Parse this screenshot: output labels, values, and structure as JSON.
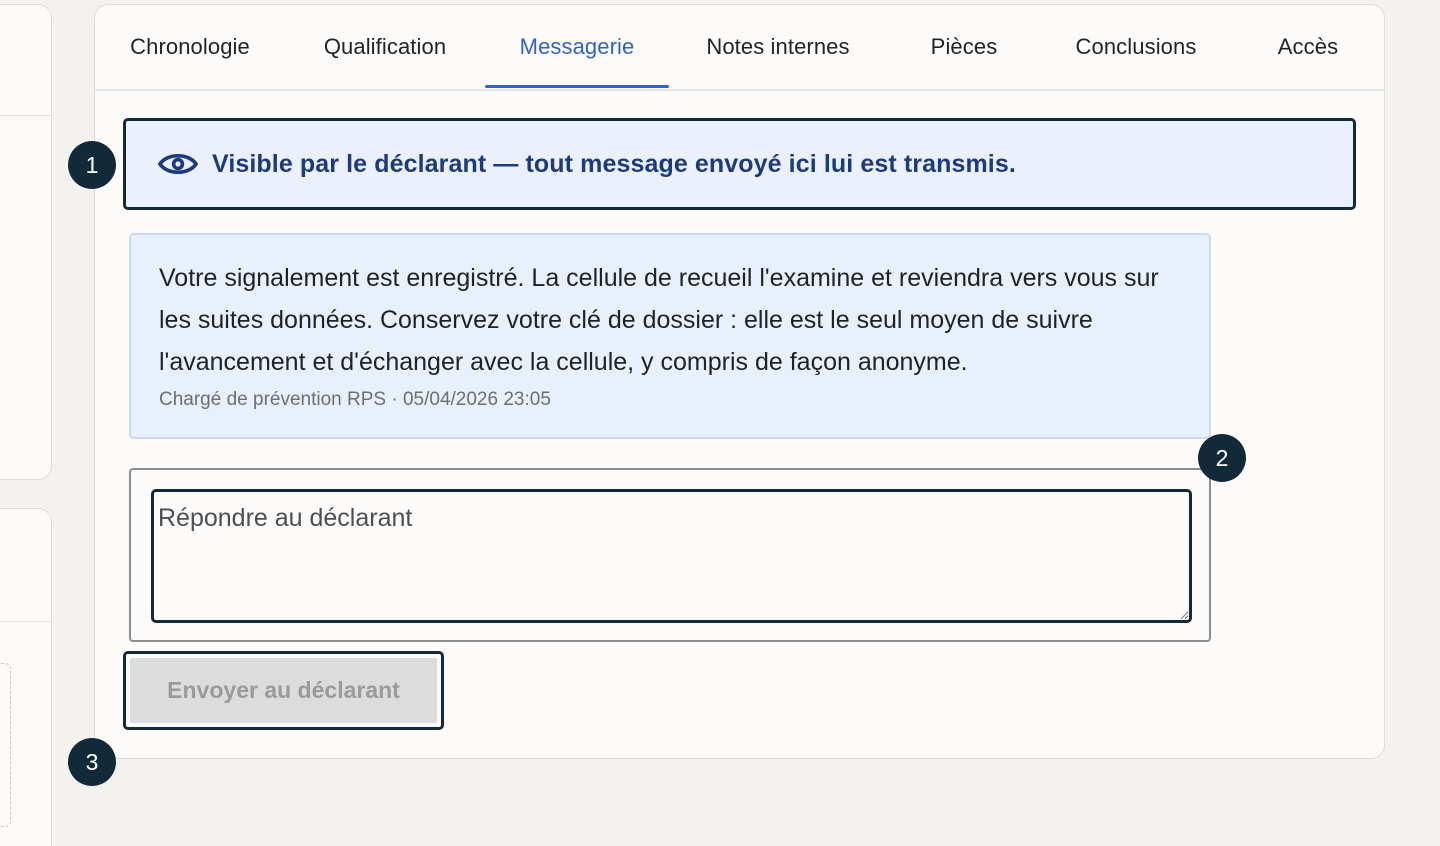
{
  "tabs": [
    {
      "label": "Chronologie"
    },
    {
      "label": "Qualification"
    },
    {
      "label": "Messagerie"
    },
    {
      "label": "Notes internes"
    },
    {
      "label": "Pièces"
    },
    {
      "label": "Conclusions"
    },
    {
      "label": "Accès"
    }
  ],
  "active_tab": "Messagerie",
  "banner": {
    "text": "Visible par le déclarant — tout message envoyé ici lui est transmis.",
    "icon": "eye-icon"
  },
  "message": {
    "text": "Votre signalement est enregistré. La cellule de recueil l'examine et reviendra vers vous sur les suites données. Conservez votre clé de dossier : elle est le seul moyen de suivre l'avancement et d'échanger avec la cellule, y compris de façon anonyme.",
    "meta": "Chargé de prévention RPS · 05/04/2026 23:05"
  },
  "reply": {
    "placeholder": "Répondre au déclarant",
    "value": ""
  },
  "send_button": {
    "label": "Envoyer au déclarant",
    "disabled": true
  },
  "markers": [
    "1",
    "2",
    "3"
  ],
  "colors": {
    "accent": "#2f64c4",
    "banner_bg": "#eaf1fc",
    "banner_text": "#1e3a7e",
    "focus_border": "#14293a",
    "marker_bg": "#12293a"
  }
}
